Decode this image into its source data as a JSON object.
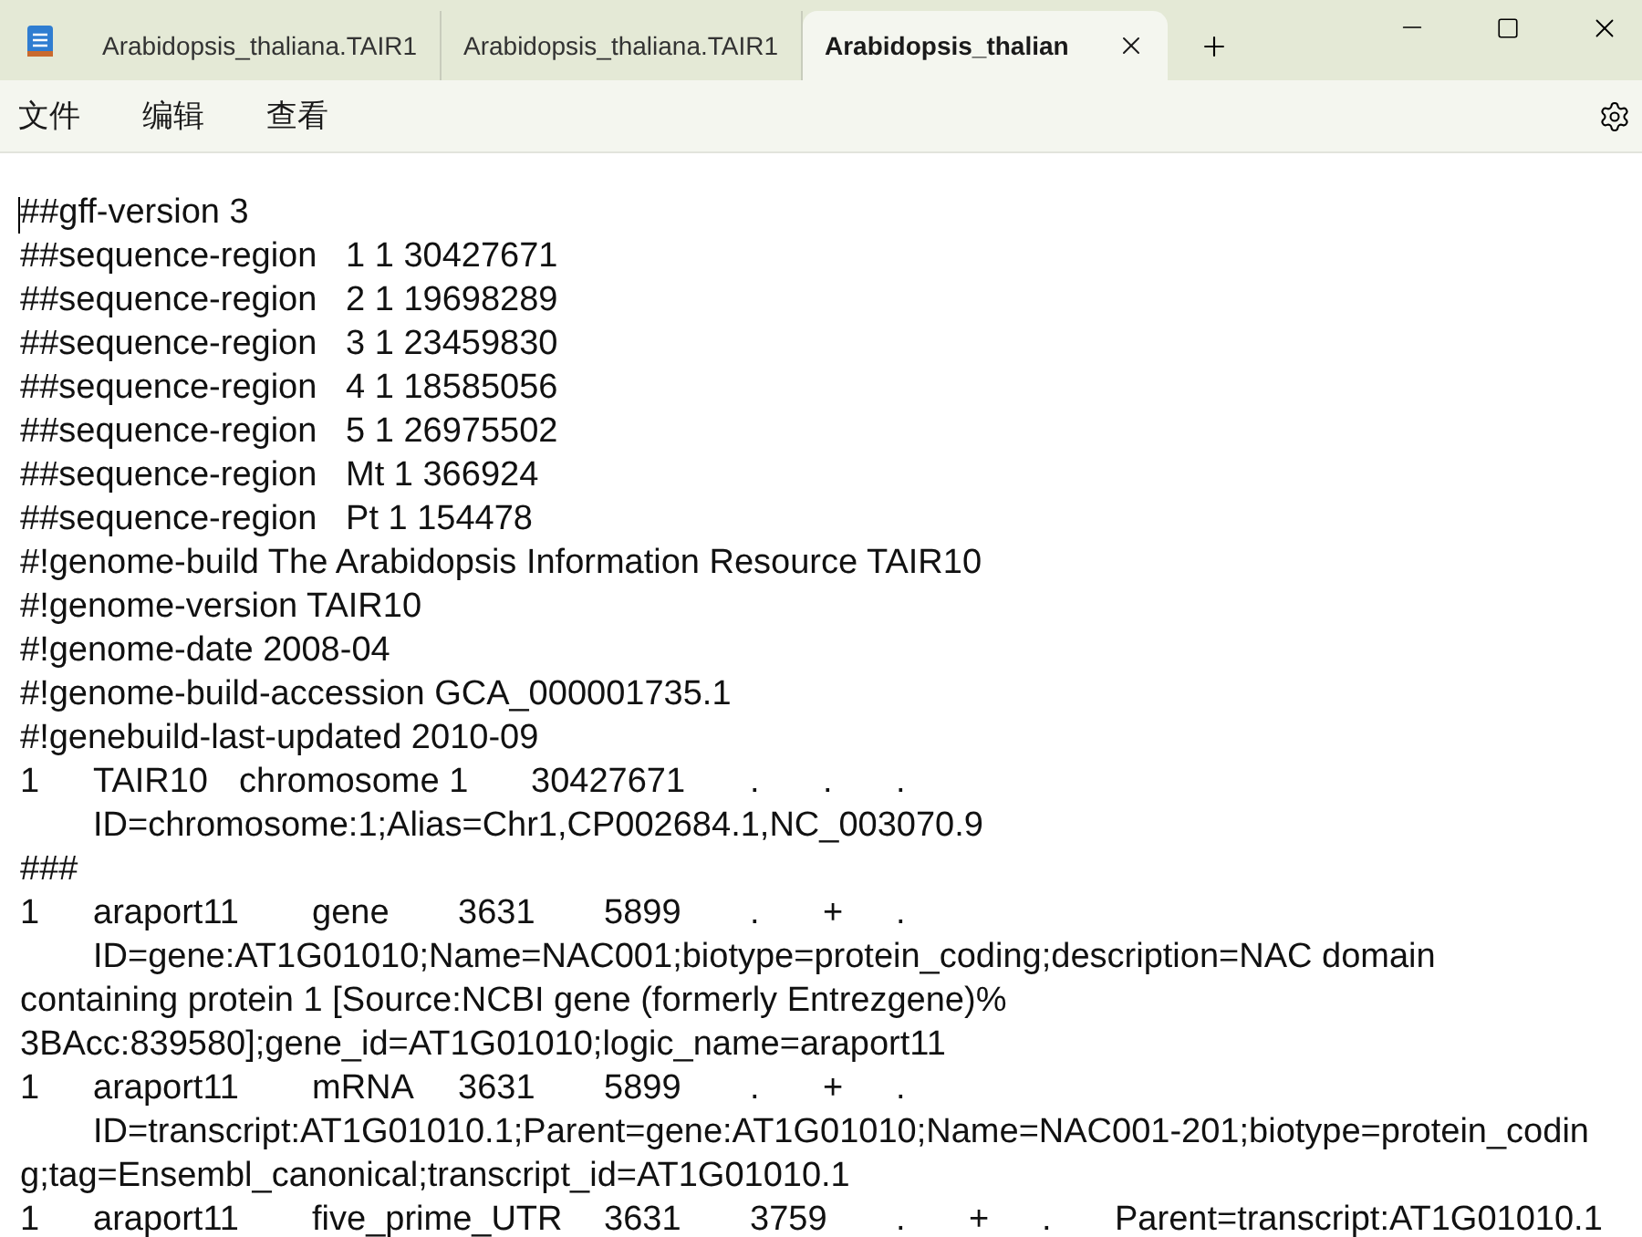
{
  "window": {
    "tabs": [
      {
        "title": "Arabidopsis_thaliana.TAIR1",
        "selected": false
      },
      {
        "title": "Arabidopsis_thaliana.TAIR1",
        "selected": false
      },
      {
        "title": "Arabidopsis_thalian",
        "selected": true
      }
    ]
  },
  "menu": [
    "文件",
    "编辑",
    "查看"
  ],
  "editor": {
    "lines": [
      "##gff-version 3",
      "##sequence-region   1 1 30427671",
      "##sequence-region   2 1 19698289",
      "##sequence-region   3 1 23459830",
      "##sequence-region   4 1 18585056",
      "##sequence-region   5 1 26975502",
      "##sequence-region   Mt 1 366924",
      "##sequence-region   Pt 1 154478",
      "#!genome-build The Arabidopsis Information Resource TAIR10",
      "#!genome-version TAIR10",
      "#!genome-date 2008-04",
      "#!genome-build-accession GCA_000001735.1",
      "#!genebuild-last-updated 2010-09",
      "1\tTAIR10\tchromosome 1\t30427671\t.\t.\t.",
      "\tID=chromosome:1;Alias=Chr1,CP002684.1,NC_003070.9",
      "###",
      "1\taraport11\tgene\t3631\t5899\t.\t+\t.",
      "\tID=gene:AT1G01010;Name=NAC001;biotype=protein_coding;description=NAC domain",
      "containing protein 1 [Source:NCBI gene (formerly Entrezgene)%",
      "3BAcc:839580];gene_id=AT1G01010;logic_name=araport11",
      "1\taraport11\tmRNA\t3631\t5899\t.\t+\t.",
      "\tID=transcript:AT1G01010.1;Parent=gene:AT1G01010;Name=NAC001-201;biotype=protein_codin",
      "g;tag=Ensembl_canonical;transcript_id=AT1G01010.1",
      "1\taraport11\tfive_prime_UTR\t3631\t3759\t.\t+\t.\tParent=transcript:AT1G01010.1"
    ]
  }
}
